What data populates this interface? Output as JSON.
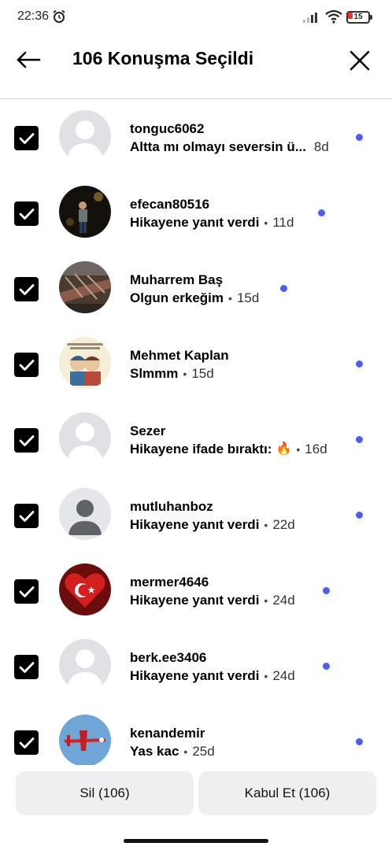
{
  "status_bar": {
    "time": "22:36",
    "battery": "15"
  },
  "header": {
    "title": "106 Konuşma Seçildi"
  },
  "conversations": [
    {
      "name": "tonguc6062",
      "preview": "Altta mı olmayı seversin ü...",
      "time": "8d",
      "avatar": "default-silhouette",
      "unread": true
    },
    {
      "name": "efecan80516",
      "preview": "Hikayene yanıt verdi",
      "time": "11d",
      "avatar": "photo-night-person",
      "unread": true
    },
    {
      "name": "Muharrem Baş",
      "preview": "Olgun erkeğim",
      "time": "15d",
      "avatar": "photo-street",
      "unread": true
    },
    {
      "name": "Mehmet Kaplan",
      "preview": "Slmmm",
      "time": "15d",
      "avatar": "photo-cartoon-couple",
      "unread": true
    },
    {
      "name": "Sezer",
      "preview": "Hikayene ifade bıraktı:",
      "time": "16d",
      "avatar": "default-silhouette",
      "unread": true,
      "emoji": "🔥"
    },
    {
      "name": "mutluhanboz",
      "preview": "Hikayene yanıt verdi",
      "time": "22d",
      "avatar": "default-person-grey",
      "unread": true
    },
    {
      "name": "mermer4646",
      "preview": "Hikayene yanıt verdi",
      "time": "24d",
      "avatar": "turkish-flag-heart",
      "unread": true
    },
    {
      "name": "berk.ee3406",
      "preview": "Hikayene yanıt verdi",
      "time": "24d",
      "avatar": "default-silhouette",
      "unread": true
    },
    {
      "name": "kenandemir",
      "preview": "Yas kac",
      "time": "25d",
      "avatar": "photo-red-plane",
      "unread": true
    }
  ],
  "actions": {
    "delete_label": "Sil (106)",
    "accept_label": "Kabul Et (106)"
  },
  "colors": {
    "unread_dot": "#4c5ef5",
    "checkbox": "#000000",
    "button_bg": "#efeff1"
  }
}
